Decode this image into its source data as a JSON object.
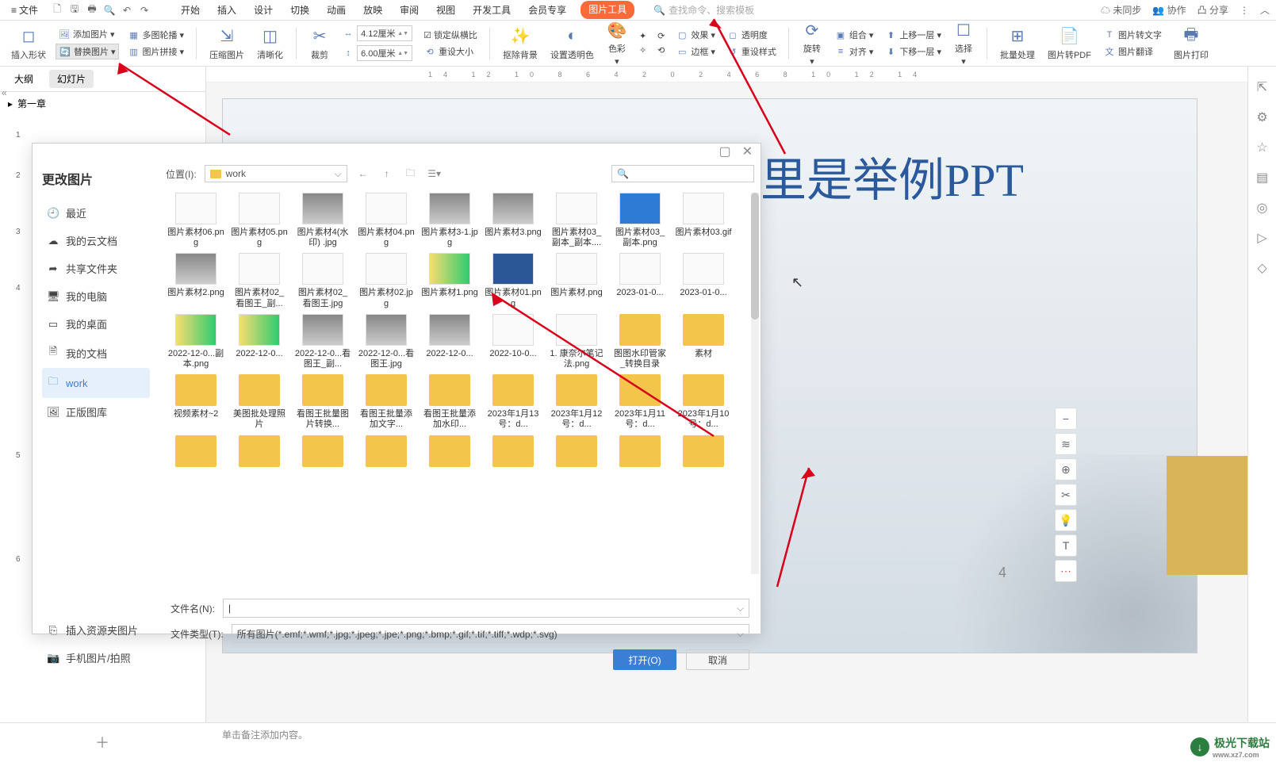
{
  "menu": {
    "file": "文件",
    "tabs": [
      "开始",
      "插入",
      "设计",
      "切换",
      "动画",
      "放映",
      "审阅",
      "视图",
      "开发工具",
      "会员专享",
      "图片工具"
    ],
    "active_tab": "图片工具",
    "search_placeholder": "查找命令、搜索模板",
    "right": {
      "sync": "未同步",
      "collab": "协作",
      "share": "分享"
    }
  },
  "ribbon": {
    "insert_shape": "插入形状",
    "add_image": "添加图片",
    "multi_outline": "多图轮播",
    "replace_image": "替换图片",
    "image_stitch": "图片拼接",
    "compress": "压缩图片",
    "clarity": "清晰化",
    "crop": "裁剪",
    "width": "4.12厘米",
    "height": "6.00厘米",
    "lock_ratio": "锁定纵横比",
    "reset_size": "重设大小",
    "remove_bg": "抠除背景",
    "transparency": "设置透明色",
    "color": "色彩",
    "effect": "效果",
    "transp": "透明度",
    "border": "边框",
    "reset_style": "重设样式",
    "rotate": "旋转",
    "group": "组合",
    "align": "对齐",
    "up_layer": "上移一层",
    "down_layer": "下移一层",
    "select": "选择",
    "batch": "批量处理",
    "to_pdf": "图片转PDF",
    "to_text": "图片转文字",
    "translate": "图片翻译",
    "print": "图片打印"
  },
  "left_panel": {
    "tabs": {
      "outline": "大纲",
      "slides": "幻灯片"
    },
    "chapter": "第一章",
    "nums": [
      "1",
      "2",
      "3",
      "4",
      "5",
      "6"
    ]
  },
  "canvas": {
    "title": "这里是举例PPT",
    "page_num": "4"
  },
  "dialog": {
    "title": "更改图片",
    "location_label": "位置(I):",
    "location_value": "work",
    "search_placeholder": "Q",
    "nav": [
      {
        "icon": "🕘",
        "label": "最近"
      },
      {
        "icon": "☁",
        "label": "我的云文档"
      },
      {
        "icon": "➦",
        "label": "共享文件夹"
      },
      {
        "icon": "🖥",
        "label": "我的电脑"
      },
      {
        "icon": "▭",
        "label": "我的桌面"
      },
      {
        "icon": "🗎",
        "label": "我的文档"
      },
      {
        "icon": "🗀",
        "label": "work",
        "selected": true
      },
      {
        "icon": "🖼",
        "label": "正版图库"
      }
    ],
    "bottom_nav": [
      {
        "icon": "⎘",
        "label": "插入资源夹图片"
      },
      {
        "icon": "📷",
        "label": "手机图片/拍照"
      }
    ],
    "files": [
      {
        "t": "img",
        "c": "",
        "n": "图片素材06.png"
      },
      {
        "t": "img",
        "c": "",
        "n": "图片素材05.png"
      },
      {
        "t": "img",
        "c": "portrait",
        "n": "图片素材4(水印) .jpg"
      },
      {
        "t": "img",
        "c": "",
        "n": "图片素材04.png"
      },
      {
        "t": "img",
        "c": "portrait",
        "n": "图片素材3-1.jpg"
      },
      {
        "t": "img",
        "c": "portrait",
        "n": "图片素材3.png"
      },
      {
        "t": "img",
        "c": "",
        "n": "图片素材03_副本_副本...."
      },
      {
        "t": "img",
        "c": "blue",
        "n": "图片素材03_副本.png"
      },
      {
        "t": "img",
        "c": "",
        "n": "图片素材03.gif"
      },
      {
        "t": "img",
        "c": "portrait",
        "n": "图片素材2.png"
      },
      {
        "t": "img",
        "c": "",
        "n": "图片素材02_看图王_副..."
      },
      {
        "t": "img",
        "c": "",
        "n": "图片素材02_看图王.jpg"
      },
      {
        "t": "img",
        "c": "",
        "n": "图片素材02.jpg"
      },
      {
        "t": "img",
        "c": "poster",
        "n": "图片素材1.png"
      },
      {
        "t": "img",
        "c": "word",
        "n": "图片素材01.png"
      },
      {
        "t": "img",
        "c": "",
        "n": "图片素材.png"
      },
      {
        "t": "img",
        "c": "",
        "n": "2023-01-0..."
      },
      {
        "t": "img",
        "c": "",
        "n": "2023-01-0..."
      },
      {
        "t": "img",
        "c": "poster",
        "n": "2022-12-0...副本.png"
      },
      {
        "t": "img",
        "c": "poster",
        "n": "2022-12-0..."
      },
      {
        "t": "img",
        "c": "portrait",
        "n": "2022-12-0...看图王_副..."
      },
      {
        "t": "img",
        "c": "portrait",
        "n": "2022-12-0...看图王.jpg"
      },
      {
        "t": "img",
        "c": "portrait",
        "n": "2022-12-0..."
      },
      {
        "t": "img",
        "c": "",
        "n": "2022-10-0..."
      },
      {
        "t": "img",
        "c": "",
        "n": "1. 康奈尔笔记法.png"
      },
      {
        "t": "folder",
        "c": "folder",
        "n": "图图水印管家_转换目录"
      },
      {
        "t": "folder",
        "c": "folder",
        "n": "素材"
      },
      {
        "t": "folder",
        "c": "folder",
        "n": "视频素材~2"
      },
      {
        "t": "folder",
        "c": "folder",
        "n": "美图批处理照片"
      },
      {
        "t": "folder",
        "c": "folder",
        "n": "看图王批量图片转换..."
      },
      {
        "t": "folder",
        "c": "folder",
        "n": "看图王批量添加文字..."
      },
      {
        "t": "folder",
        "c": "folder",
        "n": "看图王批量添加水印..."
      },
      {
        "t": "folder",
        "c": "folder",
        "n": "2023年1月13号：d..."
      },
      {
        "t": "folder",
        "c": "folder",
        "n": "2023年1月12号：d..."
      },
      {
        "t": "folder",
        "c": "folder",
        "n": "2023年1月11号：d..."
      },
      {
        "t": "folder",
        "c": "folder",
        "n": "2023年1月10号：d..."
      },
      {
        "t": "folder",
        "c": "folder",
        "n": ""
      },
      {
        "t": "folder",
        "c": "folder",
        "n": ""
      },
      {
        "t": "folder",
        "c": "folder",
        "n": ""
      },
      {
        "t": "folder",
        "c": "folder",
        "n": ""
      },
      {
        "t": "folder",
        "c": "folder",
        "n": ""
      },
      {
        "t": "folder",
        "c": "folder",
        "n": ""
      },
      {
        "t": "folder",
        "c": "folder",
        "n": ""
      },
      {
        "t": "folder",
        "c": "folder",
        "n": ""
      },
      {
        "t": "folder",
        "c": "folder",
        "n": ""
      }
    ],
    "filename_label": "文件名(N):",
    "filetype_label": "文件类型(T):",
    "filetype_value": "所有图片(*.emf;*.wmf;*.jpg;*.jpeg;*.jpe;*.png;*.bmp;*.gif;*.tif;*.tiff;*.wdp;*.svg)",
    "open_btn": "打开(O)",
    "cancel_btn": "取消"
  },
  "status": "单击备注添加内容。",
  "watermark": {
    "brand": "极光下载站",
    "url": "www.xz7.com"
  }
}
